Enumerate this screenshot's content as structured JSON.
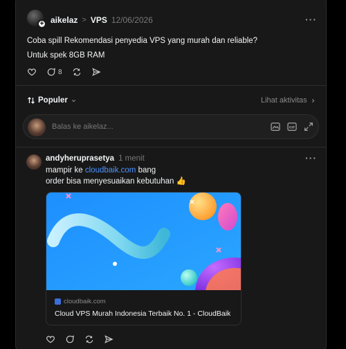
{
  "post": {
    "username": "aikelaz",
    "separator": ">",
    "topic": "VPS",
    "date": "12/06/2026",
    "more": "···",
    "text_line1": "Coba spill Rekomendasi penyedia VPS yang murah dan reliable?",
    "text_line2": "Untuk spek 8GB RAM",
    "reply_count": "8"
  },
  "sort": {
    "label": "Populer",
    "activity_label": "Lihat aktivitas"
  },
  "reply_box": {
    "placeholder": "Balas ke aikelaz..."
  },
  "comment": {
    "username": "andyheruprasetya",
    "time": "1 menit",
    "more": "···",
    "text_before_link": "mampir ke ",
    "link_text": "cloudbaik.com",
    "text_after_link": " bang",
    "text_line2": "order bisa menyesuaikan kebutuhan 👍",
    "card": {
      "domain": "cloudbaik.com",
      "title": "Cloud VPS Murah Indonesia Terbaik No. 1 - CloudBaik"
    }
  },
  "colors": {
    "background": "#000000",
    "panel": "#181818",
    "border": "#2d2d2d",
    "text": "#f3f5f7",
    "muted": "#777777",
    "link": "#4d95ff"
  },
  "icons": [
    "plus-icon",
    "heart-icon",
    "comment-icon",
    "repost-icon",
    "share-icon",
    "sort-icon",
    "chevron-down-icon",
    "chevron-right-icon",
    "image-icon",
    "gif-icon",
    "expand-icon",
    "more-icon"
  ]
}
